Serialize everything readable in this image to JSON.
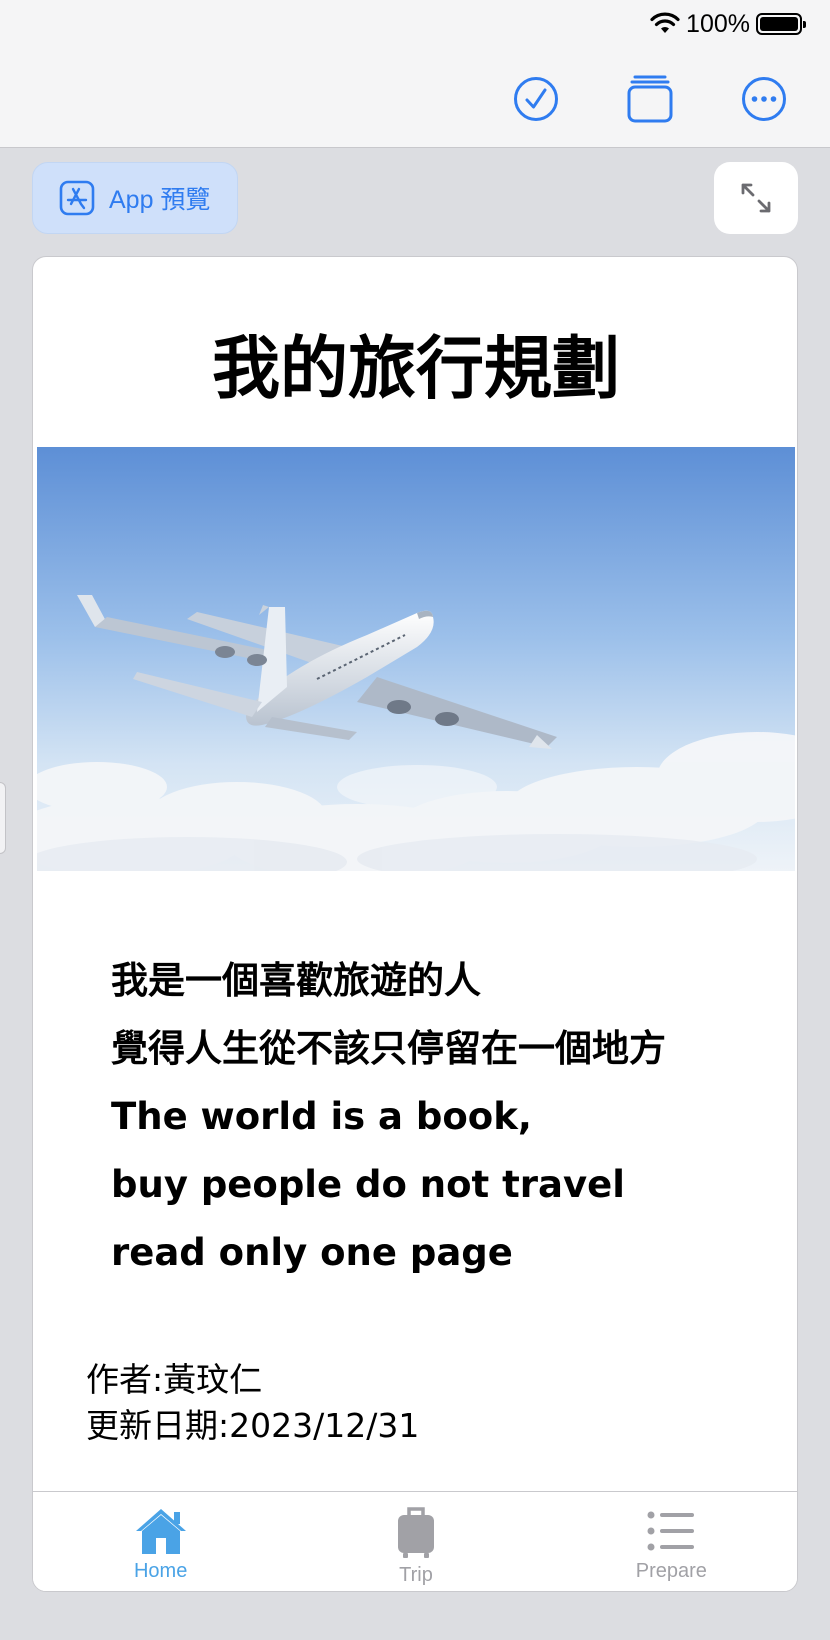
{
  "status_bar": {
    "battery_percent": "100%"
  },
  "toolbar": {
    "done_icon": "checkmark-circle-icon",
    "stack_icon": "window-stack-icon",
    "more_icon": "ellipsis-circle-icon"
  },
  "preview": {
    "app_preview_label": "App 預覽",
    "accent_color": "#2f7cf0"
  },
  "card": {
    "title": "我的旅行規劃",
    "hero_image": "airplane-in-sky",
    "lines": [
      "我是一個喜歡旅遊的人",
      "覺得人生從不該只停留在一個地方",
      "The world is a book,",
      "buy people do not travel",
      "read only one page"
    ],
    "author": "作者:黃玟仁",
    "updated": "更新日期:2023/12/31"
  },
  "tabs": [
    {
      "label": "Home",
      "icon": "house-icon",
      "selected": true
    },
    {
      "label": "Trip",
      "icon": "suitcase-icon",
      "selected": false
    },
    {
      "label": "Prepare",
      "icon": "list-icon",
      "selected": false
    }
  ],
  "colors": {
    "tab_selected": "#4aa3e6",
    "tab_unselected": "#a1a1a6"
  }
}
